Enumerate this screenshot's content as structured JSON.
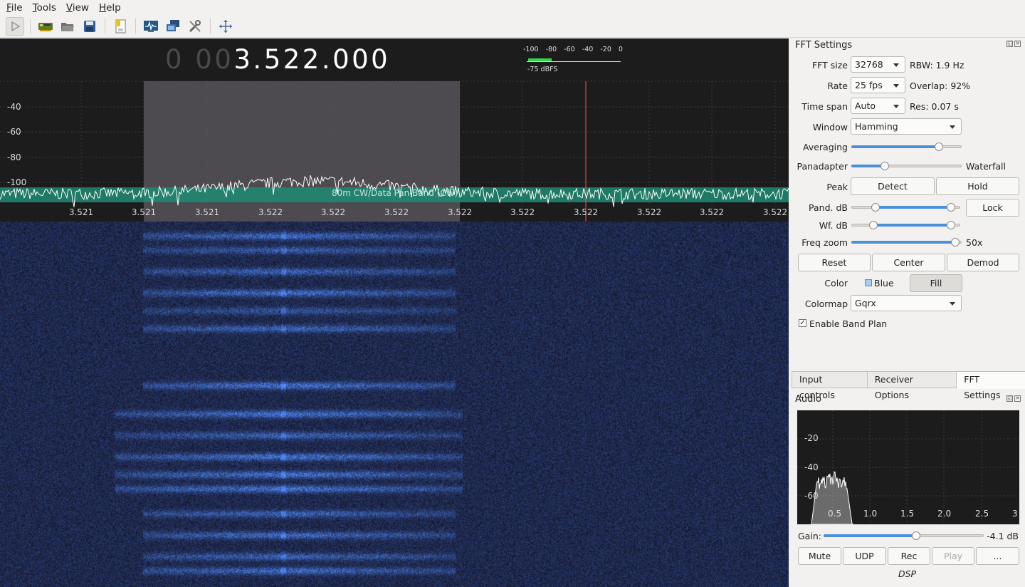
{
  "menu": [
    "File",
    "Tools",
    "View",
    "Help"
  ],
  "toolbar": {
    "icons": [
      "start-dsp-icon",
      "io-devices-icon",
      "open-settings-icon",
      "save-settings-icon",
      "bookmarks-icon",
      "audio-fft-icon",
      "remote-control-icon",
      "config-tools-icon",
      "fullscreen-icon"
    ]
  },
  "frequency": {
    "dim": "0 00",
    "value": "3.522.000"
  },
  "meter": {
    "scale": [
      "-100",
      "-80",
      "-60",
      "-40",
      "-20",
      "0"
    ],
    "level_dbfs": -75,
    "label": "-75 dBFS"
  },
  "plotter": {
    "y_labels": [
      "-40",
      "-60",
      "-80",
      "-100"
    ],
    "x_labels": [
      "3.521",
      "3.521",
      "3.521",
      "3.522",
      "3.522",
      "3.522",
      "3.522",
      "3.522",
      "3.522",
      "3.522",
      "3.522",
      "3.522"
    ],
    "band_plan_label": "80m CW/Data Pan-Band (CW)",
    "colors": {
      "band": "#1e8a72",
      "filter": "#5a575c",
      "marker": "#ff4d4d",
      "waterfall": "#1e3cff"
    }
  },
  "fft": {
    "title": "FFT Settings",
    "fft_size": {
      "label": "FFT size",
      "value": "32768",
      "note": "RBW: 1.9 Hz"
    },
    "rate": {
      "label": "Rate",
      "value": "25 fps",
      "note": "Overlap: 92%"
    },
    "time_span": {
      "label": "Time span",
      "value": "Auto",
      "note": "Res: 0.07 s"
    },
    "window": {
      "label": "Window",
      "value": "Hamming"
    },
    "averaging": {
      "label": "Averaging",
      "level": 0.82
    },
    "panadapter": {
      "label": "Panadapter",
      "right_label": "Waterfall",
      "level": 0.29
    },
    "peak": {
      "label": "Peak",
      "detect": "Detect",
      "hold": "Hold"
    },
    "pand_db": {
      "label": "Pand. dB",
      "low": 0.2,
      "high": 0.95,
      "lock": "Lock"
    },
    "wf_db": {
      "label": "Wf. dB",
      "low": 0.18,
      "high": 0.95
    },
    "freq_zoom": {
      "label": "Freq zoom",
      "value": "50x",
      "level": 0.98
    },
    "buttons": {
      "reset": "Reset",
      "center": "Center",
      "demod": "Demod"
    },
    "color": {
      "label": "Color",
      "value": "Blue",
      "fill": "Fill"
    },
    "colormap": {
      "label": "Colormap",
      "value": "Gqrx"
    },
    "band_plan": {
      "label": "Enable Band Plan",
      "checked": true
    }
  },
  "tabs": [
    "Input controls",
    "Receiver Options",
    "FFT Settings"
  ],
  "audio": {
    "title": "Audio",
    "y_labels": [
      "-20",
      "-40",
      "-60"
    ],
    "x_labels": [
      "0.5",
      "1.0",
      "1.5",
      "2.0",
      "2.5",
      "3"
    ],
    "gain_label": "Gain:",
    "gain_value": "-4.1 dB",
    "gain_level": 0.58,
    "buttons": {
      "mute": "Mute",
      "udp": "UDP",
      "rec": "Rec",
      "play": "Play",
      "more": "..."
    },
    "footer": "DSP"
  }
}
